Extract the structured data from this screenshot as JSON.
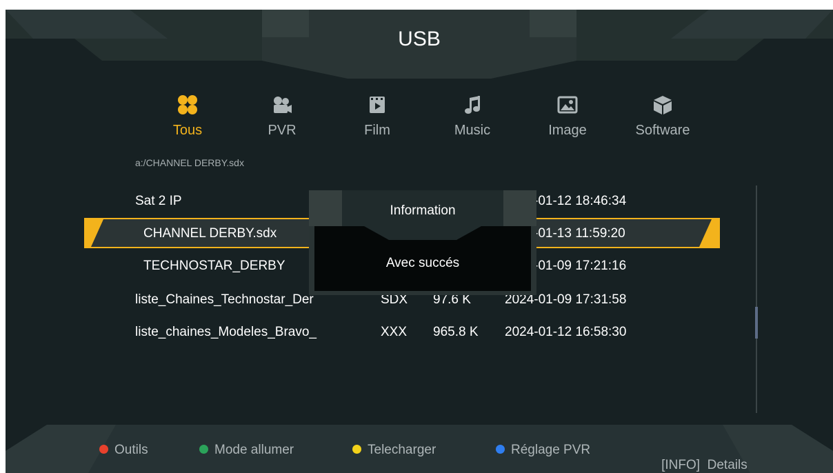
{
  "header": {
    "title": "USB"
  },
  "tabs": [
    {
      "label": "Tous",
      "icon": "all-grid-icon",
      "active": true
    },
    {
      "label": "PVR",
      "icon": "video-camera-icon",
      "active": false
    },
    {
      "label": "Film",
      "icon": "film-icon",
      "active": false
    },
    {
      "label": "Music",
      "icon": "music-note-icon",
      "active": false
    },
    {
      "label": "Image",
      "icon": "image-icon",
      "active": false
    },
    {
      "label": "Software",
      "icon": "software-box-icon",
      "active": false
    }
  ],
  "path": "a:/CHANNEL DERBY.sdx",
  "files": [
    {
      "name": "Sat 2 IP",
      "type": "",
      "size": "",
      "date": "-01-12 18:46:34"
    },
    {
      "name": "CHANNEL DERBY.sdx",
      "type": "",
      "size": "",
      "date": "-01-13 11:59:20",
      "selected": true
    },
    {
      "name": "TECHNOSTAR_DERBY",
      "type": "",
      "size": "",
      "date": "-01-09 17:21:16"
    },
    {
      "name": "liste_Chaines_Technostar_Der",
      "type": "SDX",
      "size": "97.6 K",
      "date": "2024-01-09 17:31:58"
    },
    {
      "name": "liste_chaines_Modeles_Bravo_",
      "type": "XXX",
      "size": "965.8 K",
      "date": "2024-01-12 16:58:30"
    }
  ],
  "scroll": {
    "position": 0.62
  },
  "dialog": {
    "title": "Information",
    "message": "Avec succés"
  },
  "footer": [
    {
      "label": "Outils",
      "color": "#e8412c"
    },
    {
      "label": "Mode allumer",
      "color": "#2ba35a"
    },
    {
      "label": "Telecharger",
      "color": "#f3d21a"
    },
    {
      "label": "Réglage PVR",
      "color": "#2f7ef0"
    },
    {
      "label": "[INFO]  Details",
      "color": ""
    }
  ],
  "colors": {
    "accent": "#f3b31c",
    "background": "#172123",
    "panel": "#202b2d"
  }
}
